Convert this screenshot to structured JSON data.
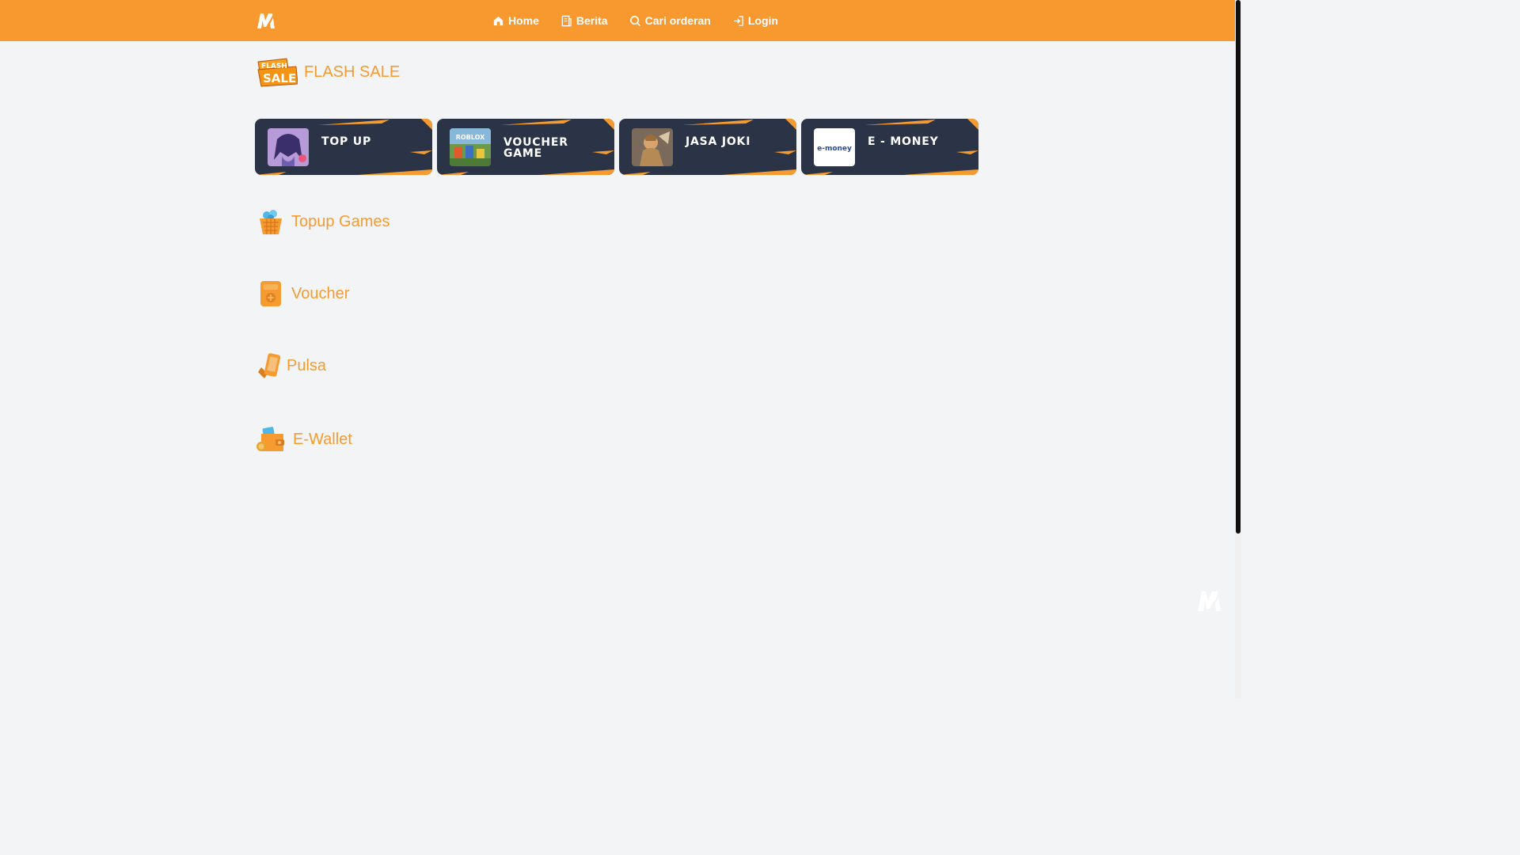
{
  "navbar": {
    "logo_icon": "brand-logo-icon",
    "links": [
      {
        "label": "Home",
        "icon": "home-icon"
      },
      {
        "label": "Berita",
        "icon": "news-icon"
      },
      {
        "label": "Cari orderan",
        "icon": "search-icon"
      },
      {
        "label": "Login",
        "icon": "login-icon"
      }
    ]
  },
  "flash_sale": {
    "badge_text": "FLASH SALE",
    "title": "FLASH SALE"
  },
  "categories": [
    {
      "label": "TOP UP",
      "thumb": "top-up-thumbnail"
    },
    {
      "label": "VOUCHER GAME",
      "thumb": "roblox-thumbnail",
      "thumb_text": "ROBLOX"
    },
    {
      "label": "JASA JOKI",
      "thumb": "hero-thumbnail"
    },
    {
      "label": "E - MONEY",
      "thumb": "emoney-thumbnail",
      "thumb_text": "e-money"
    }
  ],
  "sections": [
    {
      "title": "Topup Games",
      "icon": "basket-icon"
    },
    {
      "title": "Voucher",
      "icon": "voucher-icon"
    },
    {
      "title": "Pulsa",
      "icon": "phone-icon"
    },
    {
      "title": "E-Wallet",
      "icon": "wallet-icon"
    }
  ],
  "colors": {
    "navbar": "#f8992f",
    "accent": "#f59b2f",
    "card_bg": "#2b3347",
    "page_bg": "#f3f4f6"
  }
}
